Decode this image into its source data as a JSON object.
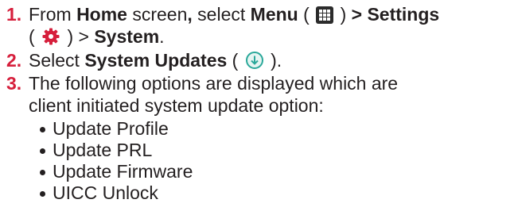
{
  "steps": [
    {
      "number": "1.",
      "line1": {
        "t1": "From ",
        "b1": "Home",
        "t2": " screen",
        "b2": ",",
        "t3": " select ",
        "b3": "Menu",
        "t4": " ( ",
        "icon1": "menu-grid-icon",
        "t5": " ) ",
        "b4": "> Settings"
      },
      "line2": {
        "t1": "( ",
        "icon2": "settings-gear-icon",
        "t2": " ) > ",
        "b1": "System",
        "t3": "."
      }
    },
    {
      "number": "2.",
      "t1": "Select ",
      "b1": "System Updates",
      "t2": " ( ",
      "icon": "system-update-icon",
      "t3": " )."
    },
    {
      "number": "3.",
      "line1": "The following options are displayed which are",
      "line2": "client initiated system update option:"
    }
  ],
  "options": [
    "Update Profile",
    "Update PRL",
    "Update Firmware",
    "UICC Unlock"
  ],
  "colors": {
    "step_number": "#d61f3c",
    "text": "#231f20",
    "gear": "#d61f3c",
    "update_icon": "#2aa89a"
  }
}
